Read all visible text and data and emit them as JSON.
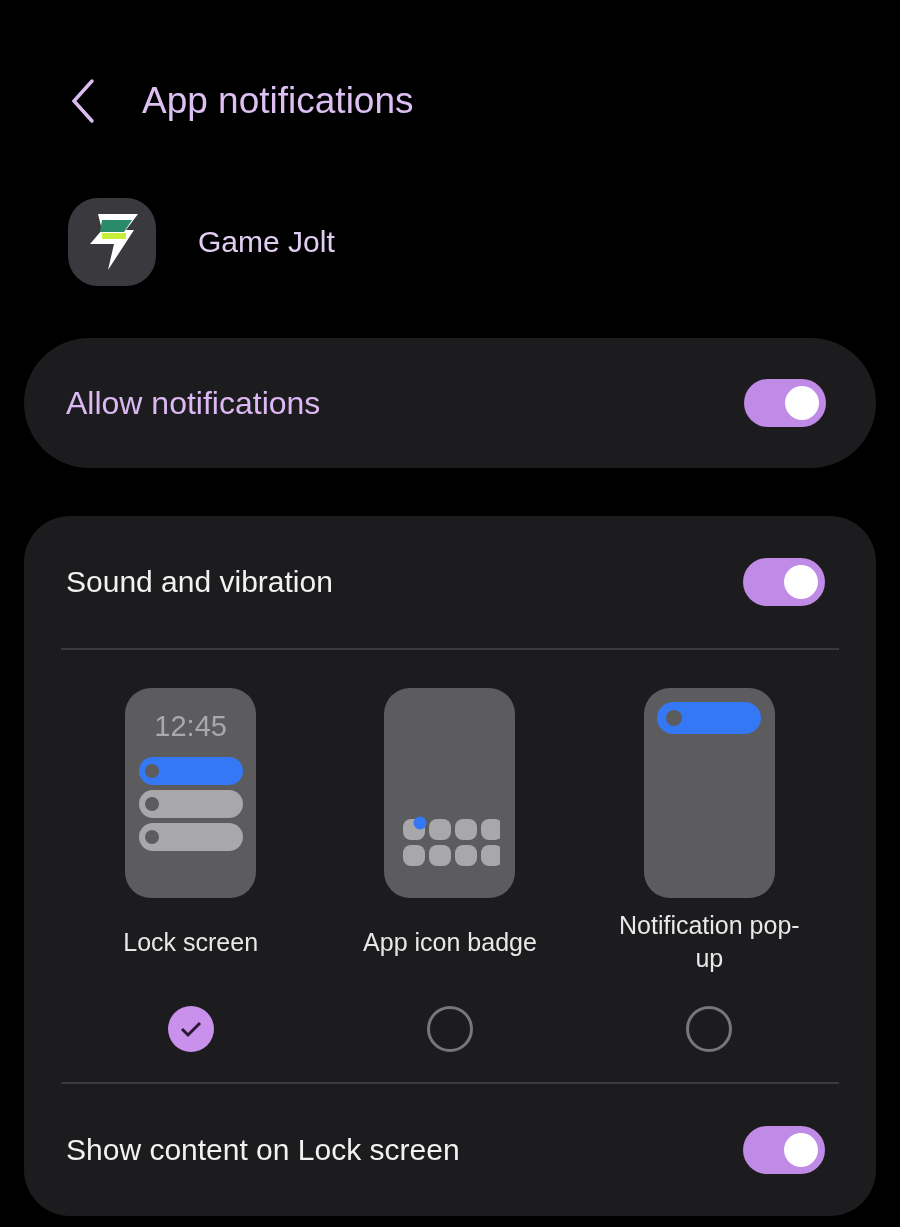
{
  "header": {
    "title": "App notifications"
  },
  "app": {
    "name": "Game Jolt"
  },
  "allow": {
    "label": "Allow notifications",
    "on": true
  },
  "sound": {
    "label": "Sound and vibration",
    "on": true
  },
  "styles": [
    {
      "kind": "lock",
      "label": "Lock screen",
      "clock": "12:45",
      "selected": true
    },
    {
      "kind": "badge",
      "label": "App icon badge",
      "selected": false
    },
    {
      "kind": "popup",
      "label": "Notification pop-up",
      "selected": false
    }
  ],
  "show_content": {
    "label": "Show content on Lock screen",
    "on": true
  }
}
